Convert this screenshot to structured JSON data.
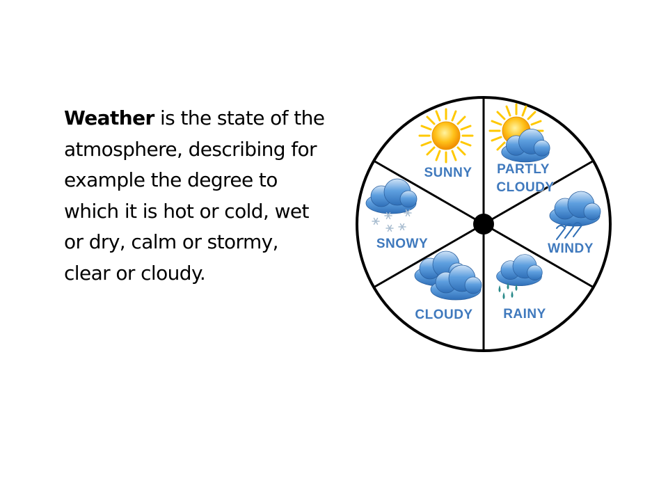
{
  "text": {
    "term": "Weather",
    "definition": " is the state of the atmosphere, describing for example the degree to which it is hot or cold, wet or dry, calm or stormy, clear or cloudy."
  },
  "wheel": {
    "segments": [
      {
        "id": "sunny",
        "label": "SUNNY",
        "icon": "sun-icon"
      },
      {
        "id": "partly-cloudy",
        "label_line1": "PARTLY",
        "label_line2": "CLOUDY",
        "icon": "sun-behind-cloud-icon"
      },
      {
        "id": "windy",
        "label": "WINDY",
        "icon": "wind-cloud-icon"
      },
      {
        "id": "rainy",
        "label": "RAINY",
        "icon": "rain-cloud-icon"
      },
      {
        "id": "cloudy",
        "label": "CLOUDY",
        "icon": "clouds-icon"
      },
      {
        "id": "snowy",
        "label": "SNOWY",
        "icon": "snow-cloud-icon"
      }
    ]
  },
  "colors": {
    "label": "#3f79bd",
    "cloud": "#4a8fd6",
    "sun": "#f7b500",
    "ring": "#000000"
  }
}
